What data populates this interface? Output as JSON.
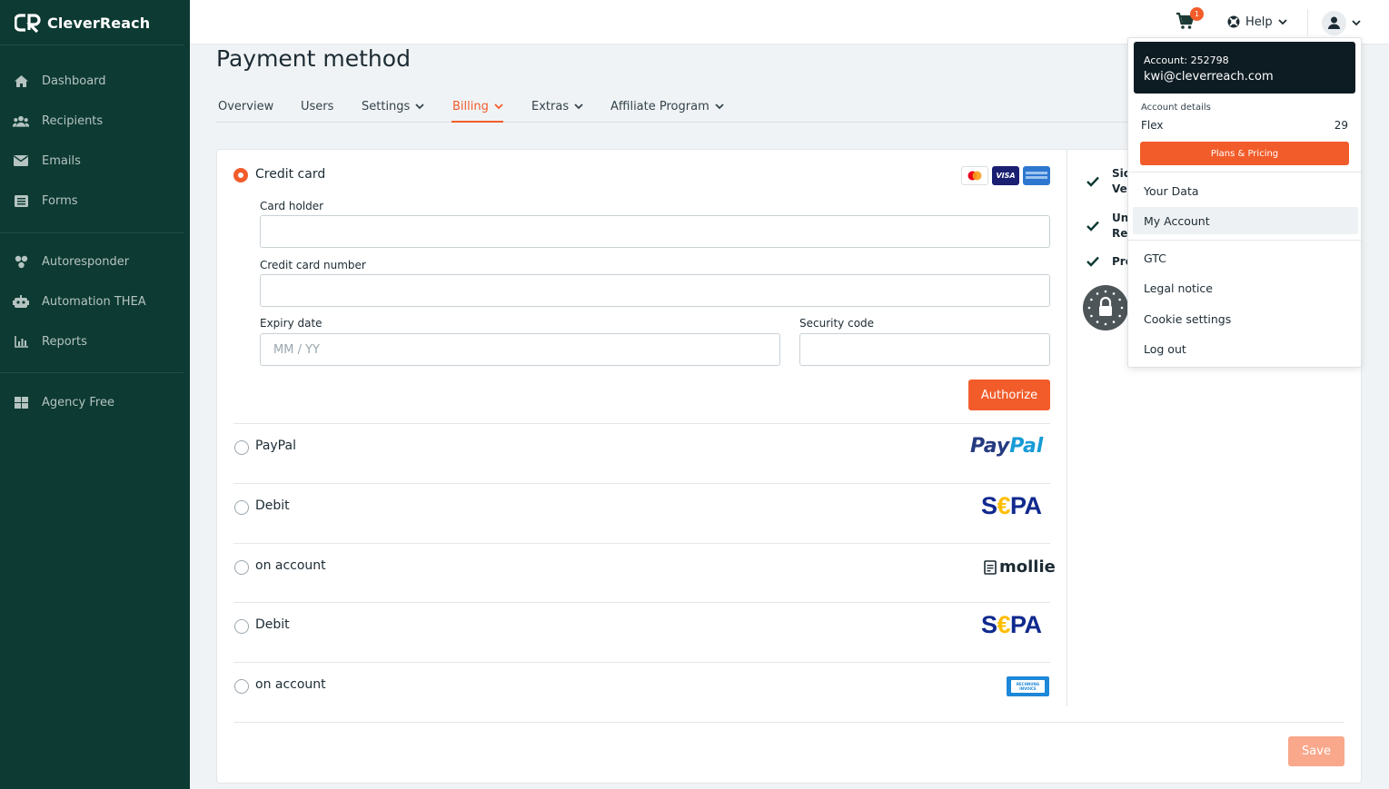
{
  "brand": {
    "name": "CleverReach"
  },
  "sidebar": {
    "items": [
      {
        "label": "Dashboard",
        "icon": "home-icon"
      },
      {
        "label": "Recipients",
        "icon": "users-icon"
      },
      {
        "label": "Emails",
        "icon": "envelope-icon"
      },
      {
        "label": "Forms",
        "icon": "form-icon"
      },
      {
        "label": "Autoresponder",
        "icon": "autoresponder-icon"
      },
      {
        "label": "Automation THEA",
        "icon": "robot-icon"
      },
      {
        "label": "Reports",
        "icon": "chart-icon"
      },
      {
        "label": "Agency Free",
        "icon": "grid-icon"
      }
    ]
  },
  "topbar": {
    "cart_count": "1",
    "help_label": "Help"
  },
  "page": {
    "title": "Payment method",
    "tabs": [
      {
        "label": "Overview"
      },
      {
        "label": "Users"
      },
      {
        "label": "Settings"
      },
      {
        "label": "Billing"
      },
      {
        "label": "Extras"
      },
      {
        "label": "Affiliate Program"
      }
    ]
  },
  "payment": {
    "options": [
      {
        "label": "Credit card",
        "selected": true
      },
      {
        "label": "PayPal"
      },
      {
        "label": "Debit"
      },
      {
        "label": "on account"
      },
      {
        "label": "Debit"
      },
      {
        "label": "on account"
      }
    ],
    "card_holder_label": "Card holder",
    "card_number_label": "Credit card number",
    "expiry_label": "Expiry date",
    "expiry_placeholder": "MM / YY",
    "security_label": "Security code",
    "authorize_label": "Authorize",
    "save_label": "Save",
    "logos": {
      "mastercard": "mastercard-icon",
      "visa_text": "VISA",
      "amex": "amex-icon",
      "paypal_pay": "Pay",
      "paypal_pal": "Pal",
      "sepa_s": "S",
      "sepa_eur": "€",
      "sepa_pa": "PA",
      "mollie_text": "mollie",
      "invoice_line1": "RECHNUNG",
      "invoice_line2": "INVOICE"
    }
  },
  "features": [
    {
      "line1": "Sic",
      "line2": "Ve"
    },
    {
      "line1": "Un",
      "line2": "Re"
    },
    {
      "line1": "Pre",
      "line2": ""
    }
  ],
  "account_menu": {
    "account_id": "Account: 252798",
    "email": "kwi@cleverreach.com",
    "details_label": "Account details",
    "plan_name": "Flex",
    "plan_value": "29",
    "pricing_label": "Plans & Pricing",
    "items_a": [
      {
        "label": "Your Data"
      },
      {
        "label": "My Account"
      }
    ],
    "items_b": [
      {
        "label": "GTC"
      },
      {
        "label": "Legal notice"
      },
      {
        "label": "Cookie settings"
      },
      {
        "label": "Log out"
      }
    ]
  },
  "colors": {
    "sidebar_bg": "#0d3a33",
    "accent": "#f25c2a",
    "save_disabled": "#f9a88c",
    "account_box": "#0d1c22"
  }
}
